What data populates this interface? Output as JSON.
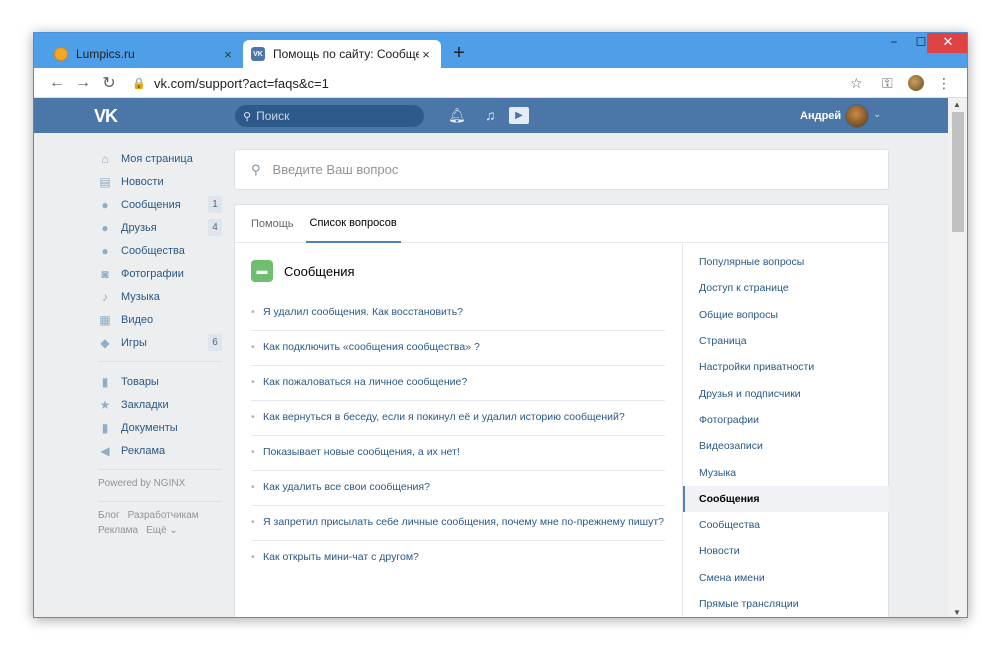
{
  "browser": {
    "tabs": [
      {
        "label": "Lumpics.ru",
        "close": "×"
      },
      {
        "label": "Помощь по сайту: Сообщения",
        "close": "×"
      }
    ],
    "new_tab": "+",
    "window_buttons": {
      "min": "−",
      "max": "☐",
      "close": "✕"
    },
    "url": "vk.com/support?act=faqs&c=1",
    "icons": {
      "back": "←",
      "forward": "→",
      "reload": "↻",
      "lock": "🔒",
      "star": "☆",
      "key": "⚿",
      "menu": "⋮"
    }
  },
  "vk_header": {
    "logo": "VK",
    "search_placeholder": "Поиск",
    "user_name": "Андрей"
  },
  "sidebar": {
    "items": [
      {
        "label": "Моя страница",
        "icon": "home-icon",
        "glyph": "⌂"
      },
      {
        "label": "Новости",
        "icon": "news-icon",
        "glyph": "▤"
      },
      {
        "label": "Сообщения",
        "icon": "messages-icon",
        "glyph": "●",
        "count": "1"
      },
      {
        "label": "Друзья",
        "icon": "friends-icon",
        "glyph": "●",
        "count": "4"
      },
      {
        "label": "Сообщества",
        "icon": "communities-icon",
        "glyph": "●"
      },
      {
        "label": "Фотографии",
        "icon": "photos-icon",
        "glyph": "◙"
      },
      {
        "label": "Музыка",
        "icon": "music-icon",
        "glyph": "♪"
      },
      {
        "label": "Видео",
        "icon": "video-icon",
        "glyph": "▦"
      },
      {
        "label": "Игры",
        "icon": "games-icon",
        "glyph": "◆",
        "count": "6"
      }
    ],
    "items2": [
      {
        "label": "Товары",
        "icon": "goods-icon",
        "glyph": "▮"
      },
      {
        "label": "Закладки",
        "icon": "bookmarks-icon",
        "glyph": "★"
      },
      {
        "label": "Документы",
        "icon": "documents-icon",
        "glyph": "▮"
      },
      {
        "label": "Реклама",
        "icon": "ads-icon",
        "glyph": "◀"
      }
    ],
    "powered": "Powered by NGINX",
    "footer": [
      [
        "Блог",
        "Разработчикам"
      ],
      [
        "Реклама",
        "Ещё ⌄"
      ]
    ]
  },
  "main": {
    "search_placeholder": "Введите Ваш вопрос",
    "tabs": [
      "Помощь",
      "Список вопросов"
    ],
    "section_title": "Сообщения",
    "questions": [
      "Я удалил сообщения. Как восстановить?",
      "Как подключить «сообщения сообщества» ?",
      "Как пожаловаться на личное сообщение?",
      "Как вернуться в беседу, если я покинул её и удалил историю сообщений?",
      "Показывает новые сообщения, а их нет!",
      "Как удалить все свои сообщения?",
      "Я запретил присылать себе личные сообщения, почему мне по-прежнему пишут?",
      "Как открыть мини-чат с другом?"
    ],
    "categories": [
      "Популярные вопросы",
      "Доступ к странице",
      "Общие вопросы",
      "Страница",
      "Настройки приватности",
      "Друзья и подписчики",
      "Фотографии",
      "Видеозаписи",
      "Музыка",
      "Сообщения",
      "Сообщества",
      "Новости",
      "Смена имени",
      "Прямые трансляции"
    ],
    "selected_category": "Сообщения"
  }
}
